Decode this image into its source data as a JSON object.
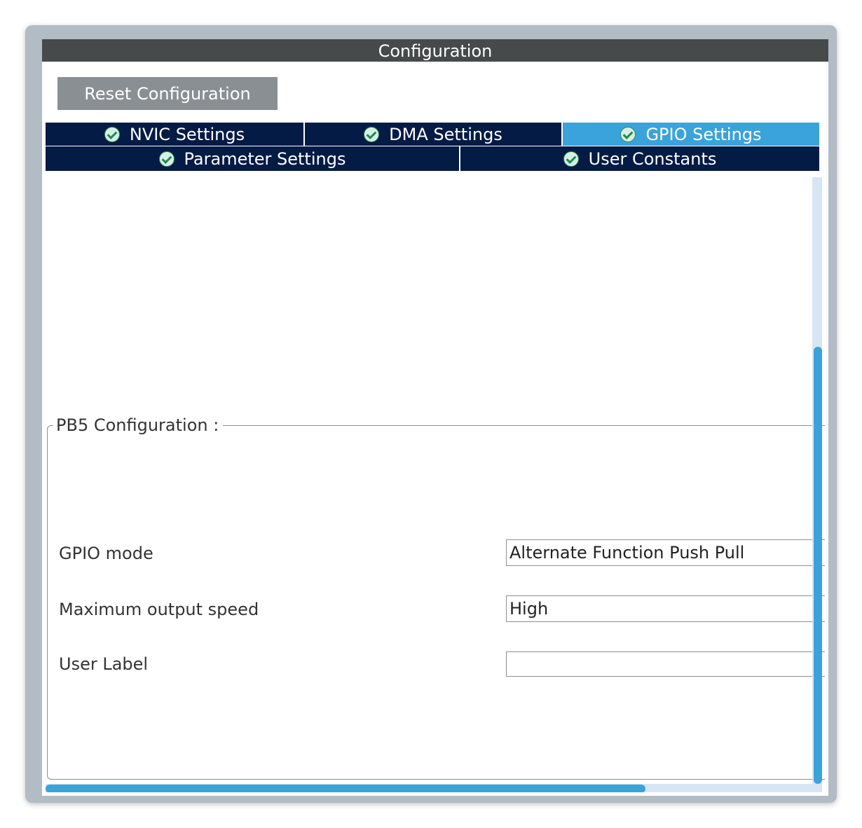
{
  "panel": {
    "title": "Configuration",
    "reset_label": "Reset Configuration"
  },
  "tabs": [
    {
      "label": "NVIC Settings",
      "icon": "check-circle-icon",
      "active": false
    },
    {
      "label": "DMA Settings",
      "icon": "check-circle-icon",
      "active": false
    },
    {
      "label": "GPIO Settings",
      "icon": "check-circle-icon",
      "active": true
    },
    {
      "label": "Parameter Settings",
      "icon": "check-circle-icon",
      "active": false
    },
    {
      "label": "User Constants",
      "icon": "check-circle-icon",
      "active": false
    }
  ],
  "pin_config": {
    "title": "PB5 Configuration :",
    "fields": [
      {
        "label": "GPIO mode",
        "value": "Alternate Function Push Pull"
      },
      {
        "label": "Maximum output speed",
        "value": "High"
      },
      {
        "label": "User Label",
        "value": ""
      }
    ]
  },
  "colors": {
    "title_bar": "#474a4b",
    "tab_inactive": "#041b45",
    "tab_active": "#3aa3da",
    "scrollbar": "#3aa3da"
  }
}
